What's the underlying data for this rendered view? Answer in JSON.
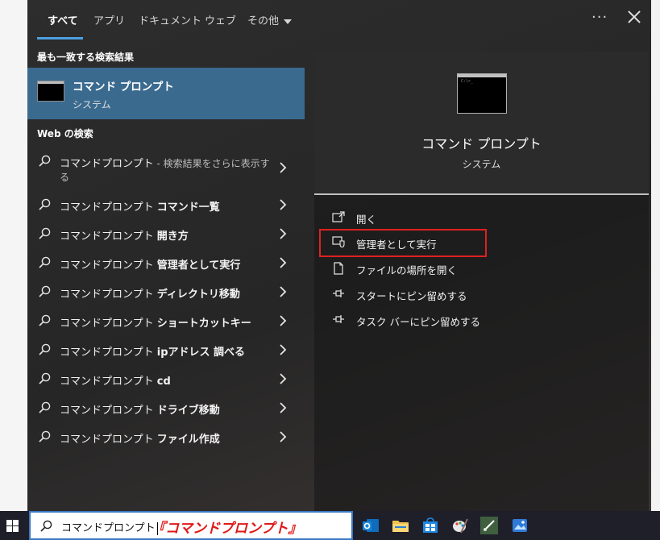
{
  "tabs": [
    {
      "label": "すべて",
      "active": true
    },
    {
      "label": "アプリ"
    },
    {
      "label": "ドキュメント"
    },
    {
      "label": "ウェブ"
    },
    {
      "label": "その他"
    }
  ],
  "left": {
    "best_match_heading": "最も一致する検索結果",
    "best_match": {
      "title": "コマンド プロンプト",
      "subtitle": "システム",
      "icon": "command-prompt-icon"
    },
    "web_heading": "Web の検索",
    "web_items": [
      {
        "prefix": "コマンドプロンプト",
        "bold": "",
        "dim": " - 検索結果をさらに表示す",
        "line2": "る"
      },
      {
        "prefix": "コマンドプロンプト ",
        "bold": "コマンド一覧"
      },
      {
        "prefix": "コマンドプロンプト ",
        "bold": "開き方"
      },
      {
        "prefix": "コマンドプロンプト ",
        "bold": "管理者として実行"
      },
      {
        "prefix": "コマンドプロンプト ",
        "bold": "ディレクトリ移動"
      },
      {
        "prefix": "コマンドプロンプト ",
        "bold": "ショートカットキー"
      },
      {
        "prefix": "コマンドプロンプト ",
        "bold": "ipアドレス 調べる"
      },
      {
        "prefix": "コマンドプロンプト ",
        "bold": "cd"
      },
      {
        "prefix": "コマンドプロンプト ",
        "bold": "ドライブ移動"
      },
      {
        "prefix": "コマンドプロンプト ",
        "bold": "ファイル作成"
      }
    ]
  },
  "right": {
    "title": "コマンド プロンプト",
    "subtitle": "システム",
    "actions": [
      {
        "label": "開く",
        "icon": "open-icon"
      },
      {
        "label": "管理者として実行",
        "icon": "shield-icon"
      },
      {
        "label": "ファイルの場所を開く",
        "icon": "file-icon"
      },
      {
        "label": "スタートにピン留めする",
        "icon": "pin-icon"
      },
      {
        "label": "タスク バーにピン留めする",
        "icon": "pin-icon"
      }
    ]
  },
  "taskbar": {
    "search_value": "コマンドプロンプト",
    "annotation": "『コマンドプロンプト』",
    "icons": [
      "outlook-icon",
      "file-explorer-icon",
      "store-icon",
      "paint-icon",
      "snipping-tool-icon",
      "photos-icon"
    ]
  },
  "colors": {
    "accent": "#4ca0e0",
    "selection": "#3b6a8f",
    "highlight_box": "#e02020",
    "annotation_text": "#e01818"
  }
}
